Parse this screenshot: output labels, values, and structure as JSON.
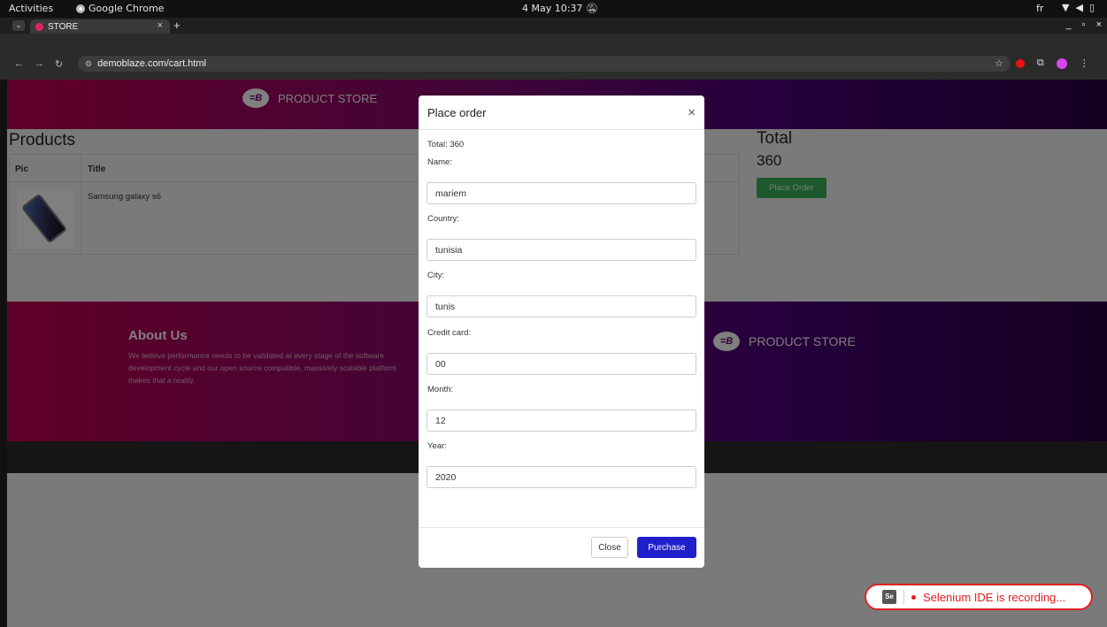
{
  "system_bar": {
    "activities": "Activities",
    "app_name": "Google Chrome",
    "clock": "4 May  10:37",
    "clock_icon": "bell-off-icon",
    "language": "fr",
    "tray_icons": [
      "wifi-icon",
      "volume-icon",
      "battery-icon"
    ]
  },
  "browser": {
    "tab_title": "STORE",
    "tab_close": "×",
    "new_tab": "+",
    "window_controls": [
      "_",
      "▫",
      "×"
    ],
    "url": "demoblaze.com/cart.html"
  },
  "site": {
    "brand": "PRODUCT STORE",
    "brand_logo_text": "=B",
    "products_heading": "Products",
    "table_headers": {
      "pic": "Pic",
      "title": "Title"
    },
    "cart_items": [
      {
        "title": "Samsung galaxy s6"
      }
    ],
    "total_heading": "Total",
    "total_value": "360",
    "place_order_label": "Place Order",
    "about_title": "About Us",
    "about_text": "We believe performance needs to be validated at every stage of the software development cycle and our open source compatible, massively scalable platform makes that a reality."
  },
  "modal": {
    "title": "Place order",
    "close_x": "×",
    "total_label": "Total: 360",
    "fields": {
      "name": {
        "label": "Name:",
        "value": "mariem"
      },
      "country": {
        "label": "Country:",
        "value": "tunisia"
      },
      "city": {
        "label": "City:",
        "value": "tunis"
      },
      "card": {
        "label": "Credit card:",
        "value": "00"
      },
      "month": {
        "label": "Month:",
        "value": "12"
      },
      "year": {
        "label": "Year:",
        "value": "2020"
      }
    },
    "close_label": "Close",
    "purchase_label": "Purchase"
  },
  "selenium": {
    "logo": "Se",
    "text": "Selenium IDE is recording..."
  },
  "colors": {
    "hero_start": "#c2004f",
    "hero_end": "#2a0040",
    "place_order_green": "#3cb15a",
    "purchase_blue": "#1f1fcc",
    "selenium_red": "#e02020"
  }
}
